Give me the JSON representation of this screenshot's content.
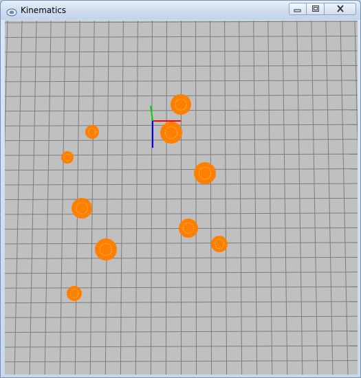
{
  "window": {
    "title": "Kinematics",
    "controls": {
      "minimize_icon": "minimize-icon",
      "maximize_icon": "maximize-icon",
      "close_icon": "close-icon"
    }
  },
  "scene": {
    "background_color": "#c0c0c0",
    "grid_color": "#7c7c7c",
    "ball_color": "#ff8000",
    "ball_highlight_color": "#ffc060",
    "axis_colors": {
      "x": "#ff0000",
      "y": "#00d000",
      "z": "#0000ff"
    },
    "ball_count": 11
  }
}
